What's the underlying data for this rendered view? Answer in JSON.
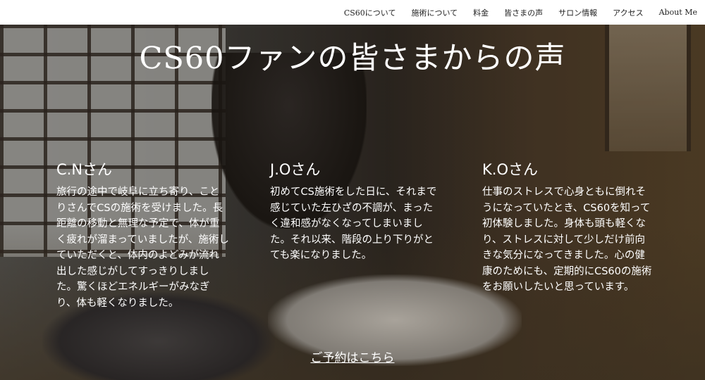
{
  "nav": {
    "items": [
      {
        "label": "CS60について"
      },
      {
        "label": "施術について"
      },
      {
        "label": "料金"
      },
      {
        "label": "皆さまの声"
      },
      {
        "label": "サロン情報"
      },
      {
        "label": "アクセス"
      },
      {
        "label": "About Me"
      }
    ]
  },
  "hero": {
    "title": "CS60ファンの皆さまからの声"
  },
  "testimonials": [
    {
      "name": "C.Nさん",
      "text": "旅行の途中で岐阜に立ち寄り、ことりさんでCSの施術を受けました。長距離の移動と無理な予定で、体が重く疲れが溜まっていましたが、施術していただくと、体内のよどみが流れ出した感じがしてすっきりしました。驚くほどエネルギーがみなぎり、体も軽くなりました。"
    },
    {
      "name": "J.Oさん",
      "text": "初めてCS施術をした日に、それまで感じていた左ひざの不調が、まったく違和感がなくなってしまいました。それ以来、階段の上り下りがとても楽になりました。"
    },
    {
      "name": "K.Oさん",
      "text": "仕事のストレスで心身ともに倒れそうになっていたとき、CS60を知って初体験しました。身体も頭も軽くなり、ストレスに対して少しだけ前向きな気分になってきました。心の健康のためにも、定期的にCS60の施術をお願いしたいと思っています。"
    }
  ],
  "cta": {
    "label": "ご予約はこちら"
  }
}
